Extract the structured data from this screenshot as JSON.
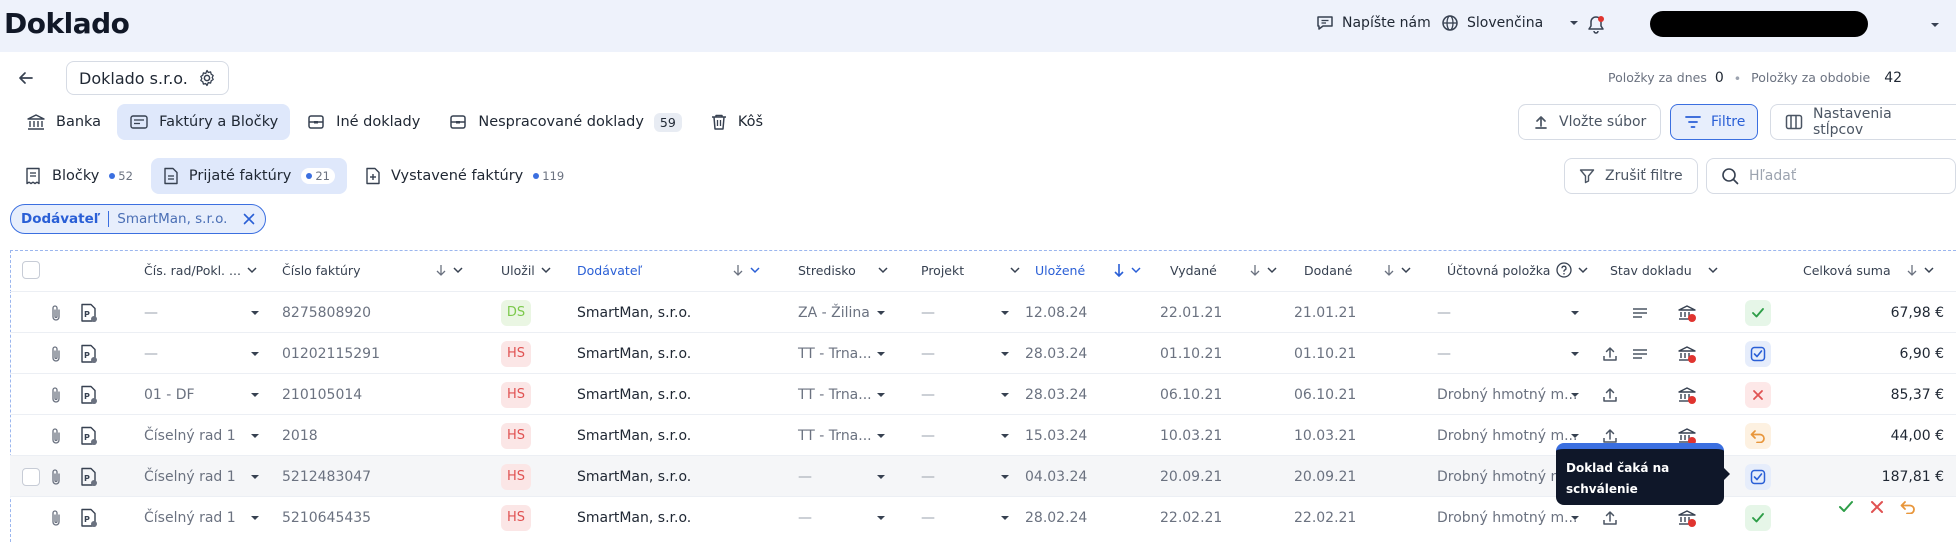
{
  "app": {
    "logo": "Doklado"
  },
  "topbar": {
    "contact_label": "Napíšte nám",
    "language": "Slovenčina"
  },
  "company": {
    "name": "Doklado s.r.o."
  },
  "counts": {
    "today_label": "Položky za dnes",
    "today_value": "0",
    "period_label": "Položky za obdobie",
    "period_value": "42"
  },
  "main_tabs": [
    {
      "label": "Banka",
      "icon": "bank-icon",
      "active": false
    },
    {
      "label": "Faktúry a Bločky",
      "icon": "receipt-icon",
      "active": true
    },
    {
      "label": "Iné doklady",
      "icon": "documents-icon",
      "active": false
    },
    {
      "label": "Nespracované doklady",
      "icon": "inbox-icon",
      "count": "59",
      "active": false
    },
    {
      "label": "Kôš",
      "icon": "trash-icon",
      "active": false
    }
  ],
  "toolbar": {
    "upload_label": "Vložte súbor",
    "filter_label": "Filtre",
    "columns_label": "Nastavenia stĺpcov",
    "clear_filters_label": "Zrušiť filtre",
    "search_placeholder": "Hľadať"
  },
  "sub_tabs": [
    {
      "label": "Bločky",
      "count": "52",
      "active": false
    },
    {
      "label": "Prijaté faktúry",
      "count": "21",
      "active": true
    },
    {
      "label": "Vystavené faktúry",
      "count": "119",
      "active": false
    }
  ],
  "filter_chip": {
    "key": "Dodávateľ",
    "value": "SmartMan, s.r.o."
  },
  "columns": [
    "Čís. rad/Pokl. ...",
    "Číslo faktúry",
    "Uložil",
    "Dodávateľ",
    "Stredisko",
    "Projekt",
    "Uložené",
    "Vydané",
    "Dodané",
    "Účtovná položka",
    "Stav dokladu",
    "Celková suma"
  ],
  "rows": [
    {
      "series": "—",
      "invoice": "8275808920",
      "by": "DS",
      "supplier": "SmartMan, s.r.o.",
      "center": "ZA - Žilina",
      "project": "—",
      "saved": "12.08.24",
      "issued": "22.01.21",
      "delivered": "21.01.21",
      "account": "—",
      "status": "ok",
      "total": "67,98 €"
    },
    {
      "series": "—",
      "invoice": "01202115291",
      "by": "HS",
      "supplier": "SmartMan, s.r.o.",
      "center": "TT - Trna...",
      "project": "—",
      "saved": "28.03.24",
      "issued": "01.10.21",
      "delivered": "01.10.21",
      "account": "—",
      "status": "chk",
      "total": "6,90 €"
    },
    {
      "series": "01 - DF",
      "invoice": "210105014",
      "by": "HS",
      "supplier": "SmartMan, s.r.o.",
      "center": "TT - Trna...",
      "project": "—",
      "saved": "28.03.24",
      "issued": "06.10.21",
      "delivered": "06.10.21",
      "account": "Drobný hmotný m...",
      "status": "bad",
      "total": "85,37 €"
    },
    {
      "series": "Číselný rad 1",
      "invoice": "2018",
      "by": "HS",
      "supplier": "SmartMan, s.r.o.",
      "center": "TT - Trna...",
      "project": "—",
      "saved": "15.03.24",
      "issued": "10.03.21",
      "delivered": "10.03.21",
      "account": "Drobný hmotný m...",
      "status": "ret",
      "total": "44,00 €"
    },
    {
      "series": "Číselný rad 1",
      "invoice": "5212483047",
      "by": "HS",
      "supplier": "SmartMan, s.r.o.",
      "center": "—",
      "project": "—",
      "saved": "04.03.24",
      "issued": "20.09.21",
      "delivered": "20.09.21",
      "account": "Drobný hmotný m...",
      "status": "chk",
      "total": "187,81 €"
    },
    {
      "series": "Číselný rad 1",
      "invoice": "5210645435",
      "by": "HS",
      "supplier": "SmartMan, s.r.o.",
      "center": "—",
      "project": "—",
      "saved": "28.02.24",
      "issued": "22.02.21",
      "delivered": "22.02.21",
      "account": "Drobný hmotný m...",
      "status": "ok",
      "total": ""
    }
  ],
  "tooltip": {
    "text": "Doklad čaká na schválenie"
  },
  "colors": {
    "accent": "#3b6fe0",
    "accent_bg": "#e7eefc",
    "topbar_bg": "#eef2fb",
    "danger": "#e05252",
    "success": "#2e9e48",
    "warning": "#e8963b"
  }
}
